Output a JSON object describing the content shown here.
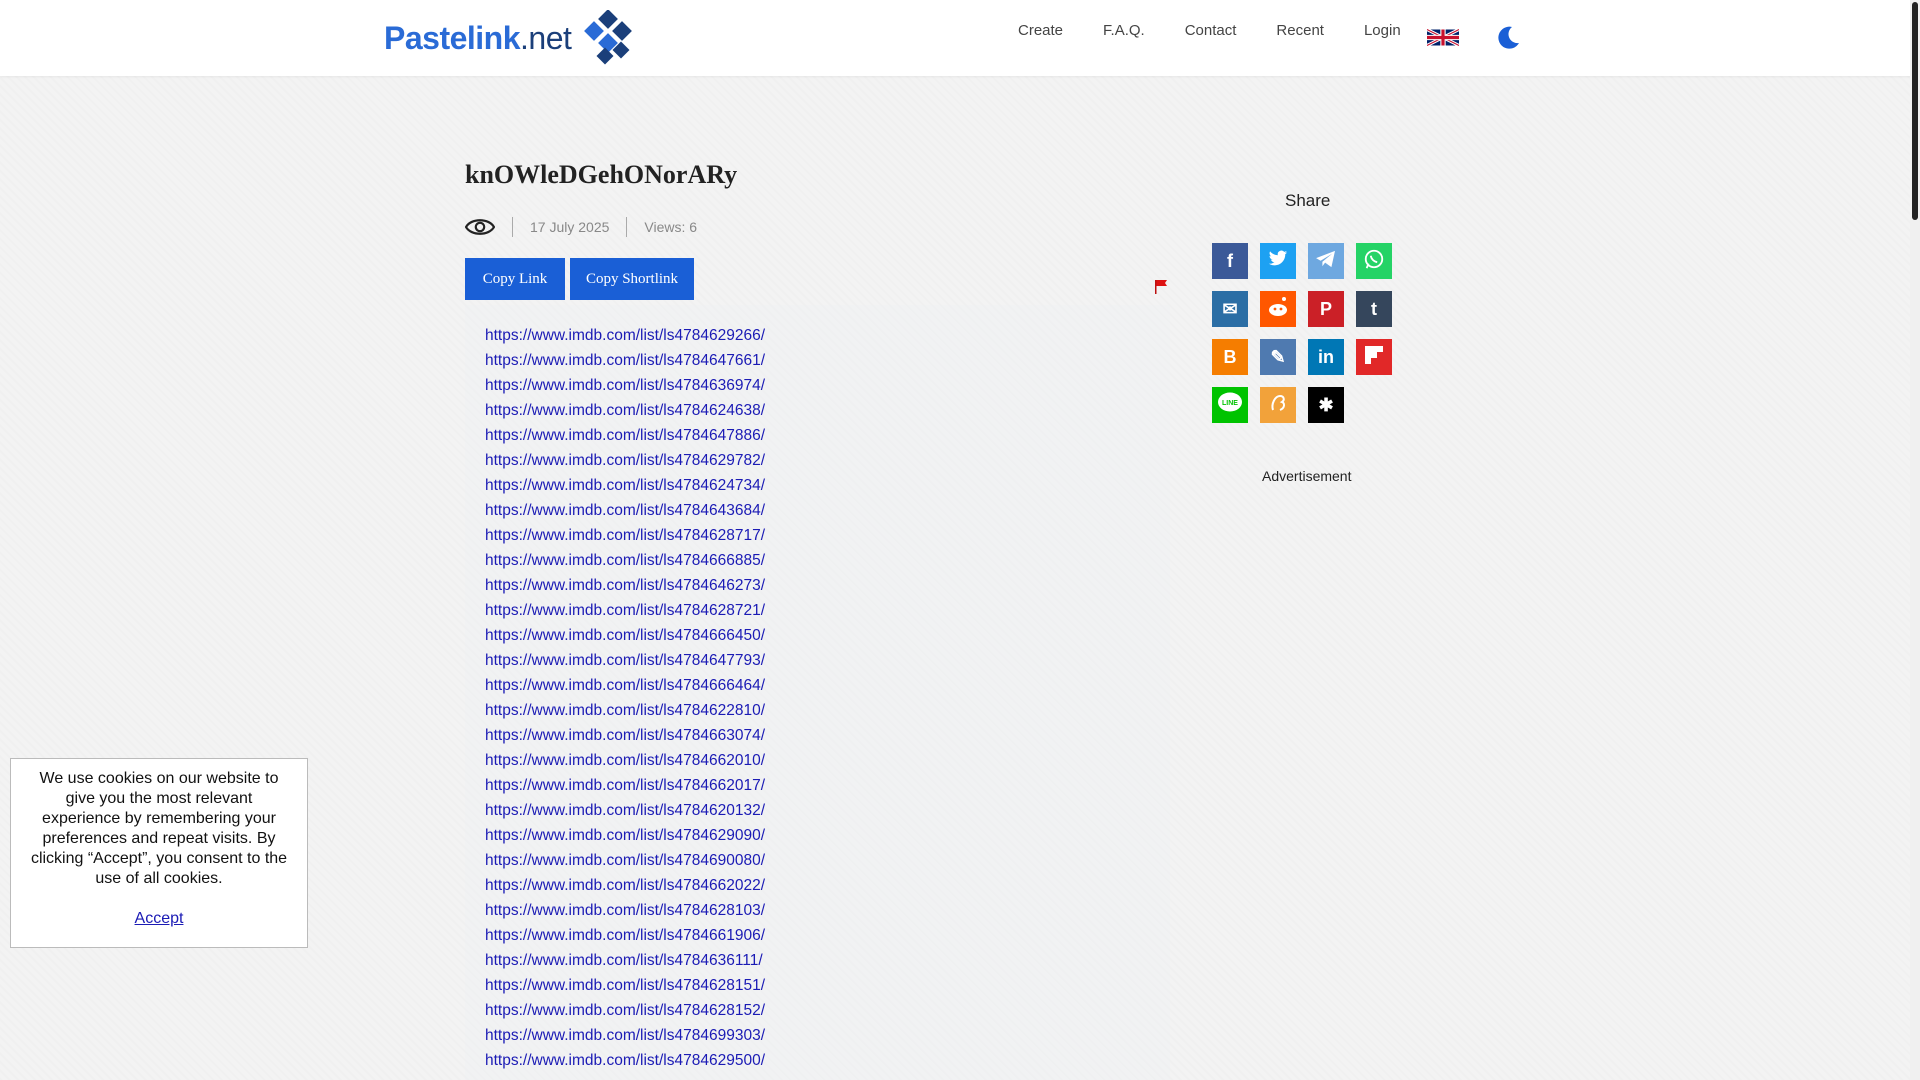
{
  "header": {
    "logo_text": "Pastelink",
    "logo_tld": ".net",
    "nav": [
      "Create",
      "F.A.Q.",
      "Contact",
      "Recent",
      "Login"
    ],
    "language_icon": "uk-flag-icon",
    "theme_icon": "moon-icon"
  },
  "paste": {
    "title": "knOWleDGehONorARy",
    "visibility_icon": "eye-icon",
    "date": "17 July 2025",
    "views": "Views: 6",
    "copy_link": "Copy Link",
    "copy_shortlink": "Copy Shortlink",
    "report_icon": "red-flag-icon",
    "links": [
      "https://www.imdb.com/list/ls4784629266/",
      "https://www.imdb.com/list/ls4784647661/",
      "https://www.imdb.com/list/ls4784636974/",
      "https://www.imdb.com/list/ls4784624638/",
      "https://www.imdb.com/list/ls4784647886/",
      "https://www.imdb.com/list/ls4784629782/",
      "https://www.imdb.com/list/ls4784624734/",
      "https://www.imdb.com/list/ls4784643684/",
      "https://www.imdb.com/list/ls4784628717/",
      "https://www.imdb.com/list/ls4784666885/",
      "https://www.imdb.com/list/ls4784646273/",
      "https://www.imdb.com/list/ls4784628721/",
      "https://www.imdb.com/list/ls4784666450/",
      "https://www.imdb.com/list/ls4784647793/",
      "https://www.imdb.com/list/ls4784666464/",
      "https://www.imdb.com/list/ls4784622810/",
      "https://www.imdb.com/list/ls4784663074/",
      "https://www.imdb.com/list/ls4784662010/",
      "https://www.imdb.com/list/ls4784662017/",
      "https://www.imdb.com/list/ls4784620132/",
      "https://www.imdb.com/list/ls4784629090/",
      "https://www.imdb.com/list/ls4784690080/",
      "https://www.imdb.com/list/ls4784662022/",
      "https://www.imdb.com/list/ls4784628103/",
      "https://www.imdb.com/list/ls4784661906/",
      "https://www.imdb.com/list/ls4784636111/",
      "https://www.imdb.com/list/ls4784628151/",
      "https://www.imdb.com/list/ls4784628152/",
      "https://www.imdb.com/list/ls4784699303/",
      "https://www.imdb.com/list/ls4784629500/"
    ]
  },
  "share": {
    "title": "Share",
    "buttons": [
      {
        "name": "facebook",
        "icon": "facebook-icon",
        "glyph": "f",
        "color": "#3b5998"
      },
      {
        "name": "twitter",
        "icon": "twitter-icon",
        "glyph": "",
        "color": "#1da1f2"
      },
      {
        "name": "telegram",
        "icon": "telegram-icon",
        "glyph": "",
        "color": "#6ea8e0"
      },
      {
        "name": "whatsapp",
        "icon": "whatsapp-icon",
        "glyph": "",
        "color": "#25d366"
      },
      {
        "name": "email",
        "icon": "email-icon",
        "glyph": "✉",
        "color": "#2b6ea5"
      },
      {
        "name": "reddit",
        "icon": "reddit-icon",
        "glyph": "",
        "color": "#ff5700"
      },
      {
        "name": "pinterest",
        "icon": "pinterest-icon",
        "glyph": "P",
        "color": "#cb2027"
      },
      {
        "name": "tumblr",
        "icon": "tumblr-icon",
        "glyph": "t",
        "color": "#35465c"
      },
      {
        "name": "blogger",
        "icon": "blogger-icon",
        "glyph": "B",
        "color": "#f57d00"
      },
      {
        "name": "livejournal",
        "icon": "livejournal-icon",
        "glyph": "✎",
        "color": "#4f7ab0"
      },
      {
        "name": "linkedin",
        "icon": "linkedin-icon",
        "glyph": "in",
        "color": "#0077b5"
      },
      {
        "name": "flipboard",
        "icon": "flipboard-icon",
        "glyph": "",
        "color": "#e12828"
      },
      {
        "name": "line",
        "icon": "line-icon",
        "glyph": "",
        "color": "#00c300"
      },
      {
        "name": "ok",
        "icon": "odnoklassniki-icon",
        "glyph": "",
        "color": "#f2a23a"
      },
      {
        "name": "livejournal-star",
        "icon": "asterisk-icon",
        "glyph": "✱",
        "color": "#000000"
      }
    ]
  },
  "advertisement": "Advertisement",
  "cookie": {
    "text": "We use cookies on our website to give you the most relevant experience by remembering your preferences and repeat visits. By clicking “Accept”, you consent to the use of all cookies.",
    "accept": "Accept"
  }
}
